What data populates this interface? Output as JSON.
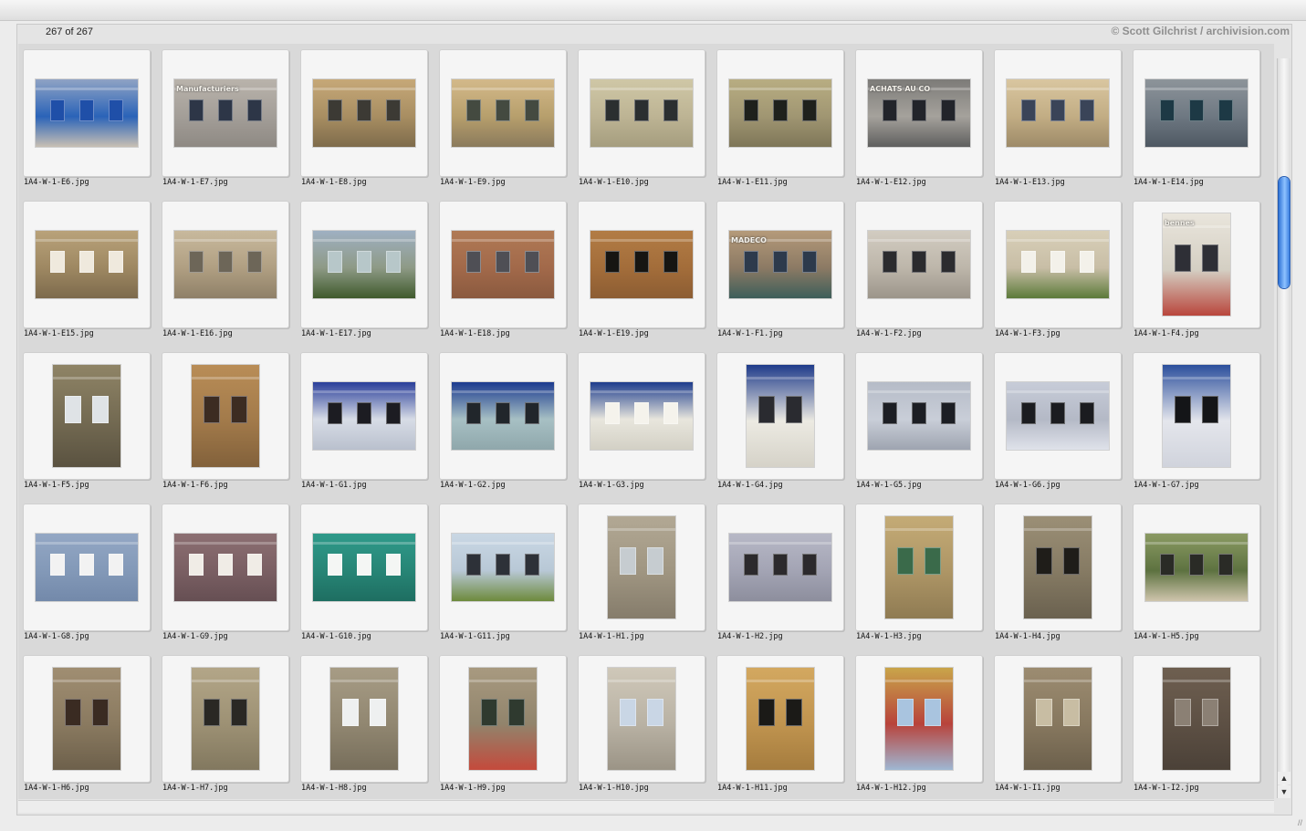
{
  "app": {
    "count_text": "267 of 267",
    "credit": "© Scott Gilchrist / archivision.com"
  },
  "colors": {
    "scroll_accent": "#3b7fe0",
    "slide_bg": "#f5f5f5",
    "grid_bg": "#d9d9d9"
  },
  "icons": {
    "scroll_up": "▲",
    "scroll_down": "▼",
    "resize": "//"
  },
  "thumbnails": [
    {
      "name": "1A4-W-1-E6.jpg",
      "orientation": "landscape",
      "palette": [
        "#8fa3c4",
        "#2a63b8",
        "#c8c0b4"
      ],
      "win": "#1f4fa8"
    },
    {
      "name": "1A4-W-1-E7.jpg",
      "orientation": "landscape",
      "palette": [
        "#b9b3ab",
        "#a39e98",
        "#8e8983"
      ],
      "win": "#2d3647",
      "overlay": "Manufacturiers"
    },
    {
      "name": "1A4-W-1-E8.jpg",
      "orientation": "landscape",
      "palette": [
        "#c6a878",
        "#a88e62",
        "#7e6b4b"
      ],
      "win": "#3c3a34"
    },
    {
      "name": "1A4-W-1-E9.jpg",
      "orientation": "landscape",
      "palette": [
        "#d3b98a",
        "#b79f6c",
        "#8a7a5c"
      ],
      "win": "#444a40"
    },
    {
      "name": "1A4-W-1-E10.jpg",
      "orientation": "landscape",
      "palette": [
        "#cfc7a6",
        "#bdb494",
        "#a59d7e"
      ],
      "win": "#2b2f30"
    },
    {
      "name": "1A4-W-1-E11.jpg",
      "orientation": "landscape",
      "palette": [
        "#b8ad82",
        "#a09672",
        "#7e7658"
      ],
      "win": "#1f211c"
    },
    {
      "name": "1A4-W-1-E12.jpg",
      "orientation": "landscape",
      "palette": [
        "#7c7b78",
        "#a5a29c",
        "#5f5f5e"
      ],
      "win": "#22242a",
      "overlay": "ACHATS AU CO"
    },
    {
      "name": "1A4-W-1-E13.jpg",
      "orientation": "landscape",
      "palette": [
        "#d9c6a0",
        "#c2ad84",
        "#9d8a68"
      ],
      "win": "#3a4458"
    },
    {
      "name": "1A4-W-1-E14.jpg",
      "orientation": "landscape",
      "palette": [
        "#8d949a",
        "#6e7882",
        "#4e5862"
      ],
      "win": "#1d3945"
    },
    {
      "name": "1A4-W-1-E15.jpg",
      "orientation": "landscape",
      "palette": [
        "#b9a27a",
        "#9e8862",
        "#7d6a4c"
      ],
      "win": "#efe9dd"
    },
    {
      "name": "1A4-W-1-E16.jpg",
      "orientation": "landscape",
      "palette": [
        "#c8b99d",
        "#b09f82",
        "#8f8068"
      ],
      "win": "#6d6658"
    },
    {
      "name": "1A4-W-1-E17.jpg",
      "orientation": "landscape",
      "palette": [
        "#9fb0c2",
        "#8e9a86",
        "#3f5a2c"
      ],
      "win": "#b7c7c9"
    },
    {
      "name": "1A4-W-1-E18.jpg",
      "orientation": "landscape",
      "palette": [
        "#b07a55",
        "#a2694a",
        "#8a5a3f"
      ],
      "win": "#4f4f55"
    },
    {
      "name": "1A4-W-1-E19.jpg",
      "orientation": "landscape",
      "palette": [
        "#b27c45",
        "#a36d3a",
        "#8c5d33"
      ],
      "win": "#161512"
    },
    {
      "name": "1A4-W-1-F1.jpg",
      "orientation": "landscape",
      "palette": [
        "#b59a7a",
        "#8c7a64",
        "#3d5e5a"
      ],
      "win": "#2d3a4c",
      "overlay": "MADECO"
    },
    {
      "name": "1A4-W-1-F2.jpg",
      "orientation": "landscape",
      "palette": [
        "#d2ccc1",
        "#bdb6aa",
        "#9c958a"
      ],
      "win": "#2b2b2e"
    },
    {
      "name": "1A4-W-1-F3.jpg",
      "orientation": "landscape",
      "palette": [
        "#d8cfb8",
        "#c8bea6",
        "#5c7a3a"
      ],
      "win": "#f3f1ea"
    },
    {
      "name": "1A4-W-1-F4.jpg",
      "orientation": "portrait",
      "palette": [
        "#e9e5dc",
        "#d4cfc3",
        "#b9463c"
      ],
      "win": "#2e2f36",
      "overlay": "bennes"
    },
    {
      "name": "1A4-W-1-F5.jpg",
      "orientation": "portrait",
      "palette": [
        "#8f8466",
        "#736a52",
        "#5a5240"
      ],
      "win": "#dfe3e6"
    },
    {
      "name": "1A4-W-1-F6.jpg",
      "orientation": "portrait",
      "palette": [
        "#b98d57",
        "#a27a4a",
        "#82613b"
      ],
      "win": "#3c2c22"
    },
    {
      "name": "1A4-W-1-G1.jpg",
      "orientation": "landscape",
      "palette": [
        "#2a3f9a",
        "#d7dce6",
        "#b9c0cd"
      ],
      "win": "#1c1c22"
    },
    {
      "name": "1A4-W-1-G2.jpg",
      "orientation": "landscape",
      "palette": [
        "#1c3b8f",
        "#a7c0c4",
        "#8fa7ab"
      ],
      "win": "#21262b"
    },
    {
      "name": "1A4-W-1-G3.jpg",
      "orientation": "landscape",
      "palette": [
        "#1d3c8c",
        "#e8e6dd",
        "#d3d0c5"
      ],
      "win": "#f5f3ec"
    },
    {
      "name": "1A4-W-1-G4.jpg",
      "orientation": "portrait",
      "palette": [
        "#1f3b8a",
        "#eceae2",
        "#d5d2c8"
      ],
      "win": "#2a2b30"
    },
    {
      "name": "1A4-W-1-G5.jpg",
      "orientation": "landscape",
      "palette": [
        "#b5bbc7",
        "#c9ced8",
        "#9ea4b0"
      ],
      "win": "#1c1e24"
    },
    {
      "name": "1A4-W-1-G6.jpg",
      "orientation": "landscape",
      "palette": [
        "#c7ccd8",
        "#b4b9c6",
        "#dfe2ea"
      ],
      "win": "#1b1c20"
    },
    {
      "name": "1A4-W-1-G7.jpg",
      "orientation": "portrait",
      "palette": [
        "#2c4f9c",
        "#e4e6ec",
        "#d0d3dc"
      ],
      "win": "#141518"
    },
    {
      "name": "1A4-W-1-G8.jpg",
      "orientation": "landscape",
      "palette": [
        "#93a7c4",
        "#8399b8",
        "#7389aa"
      ],
      "win": "#f2f2f2"
    },
    {
      "name": "1A4-W-1-G9.jpg",
      "orientation": "landscape",
      "palette": [
        "#8c6f72",
        "#7a5f63",
        "#664f53"
      ],
      "win": "#f0ece6"
    },
    {
      "name": "1A4-W-1-G10.jpg",
      "orientation": "landscape",
      "palette": [
        "#2f9a8a",
        "#278576",
        "#1e6e61"
      ],
      "win": "#f4f6f4"
    },
    {
      "name": "1A4-W-1-G11.jpg",
      "orientation": "landscape",
      "palette": [
        "#c9d7e4",
        "#b8c8d6",
        "#6d8a3c"
      ],
      "win": "#2d3138"
    },
    {
      "name": "1A4-W-1-H1.jpg",
      "orientation": "portrait",
      "palette": [
        "#b2a894",
        "#9f9581",
        "#857c6b"
      ],
      "win": "#c6ccd0"
    },
    {
      "name": "1A4-W-1-H2.jpg",
      "orientation": "landscape",
      "palette": [
        "#b7b8c6",
        "#a3a4b4",
        "#8d8e9d"
      ],
      "win": "#2c2a2d"
    },
    {
      "name": "1A4-W-1-H3.jpg",
      "orientation": "portrait",
      "palette": [
        "#c4ab76",
        "#ad9565",
        "#8f7b53"
      ],
      "win": "#3a6a4a"
    },
    {
      "name": "1A4-W-1-H4.jpg",
      "orientation": "portrait",
      "palette": [
        "#9b8f76",
        "#857a63",
        "#6a614f"
      ],
      "win": "#1f1d19"
    },
    {
      "name": "1A4-W-1-H5.jpg",
      "orientation": "landscape",
      "palette": [
        "#8b9a63",
        "#5d7240",
        "#cfc5ad"
      ],
      "win": "#2a2b26"
    },
    {
      "name": "1A4-W-1-H6.jpg",
      "orientation": "portrait",
      "palette": [
        "#a08e72",
        "#8a7a60",
        "#6d604b"
      ],
      "win": "#3a2b22"
    },
    {
      "name": "1A4-W-1-H7.jpg",
      "orientation": "portrait",
      "palette": [
        "#b3a688",
        "#9d9174",
        "#82785f"
      ],
      "win": "#2a2824"
    },
    {
      "name": "1A4-W-1-H8.jpg",
      "orientation": "portrait",
      "palette": [
        "#a79c85",
        "#918771",
        "#776e5b"
      ],
      "win": "#eef0f0"
    },
    {
      "name": "1A4-W-1-H9.jpg",
      "orientation": "portrait",
      "palette": [
        "#a89a80",
        "#91846c",
        "#c44a3c"
      ],
      "win": "#2f3a2f"
    },
    {
      "name": "1A4-W-1-H10.jpg",
      "orientation": "portrait",
      "palette": [
        "#cfc8b9",
        "#b9b2a4",
        "#9b9486"
      ],
      "win": "#c9d6e5"
    },
    {
      "name": "1A4-W-1-H11.jpg",
      "orientation": "portrait",
      "palette": [
        "#d3a860",
        "#c0944f",
        "#a57c3e"
      ],
      "win": "#1b1a17"
    },
    {
      "name": "1A4-W-1-H12.jpg",
      "orientation": "portrait",
      "palette": [
        "#c9a54a",
        "#b8433b",
        "#9fb7d3"
      ],
      "win": "#a9c4df"
    },
    {
      "name": "1A4-W-1-I1.jpg",
      "orientation": "portrait",
      "palette": [
        "#9c8c71",
        "#87785f",
        "#6c604c"
      ],
      "win": "#c8bda3"
    },
    {
      "name": "1A4-W-1-I2.jpg",
      "orientation": "portrait",
      "palette": [
        "#6e5f50",
        "#5d5044",
        "#4b4138"
      ],
      "win": "#8b8074"
    }
  ]
}
